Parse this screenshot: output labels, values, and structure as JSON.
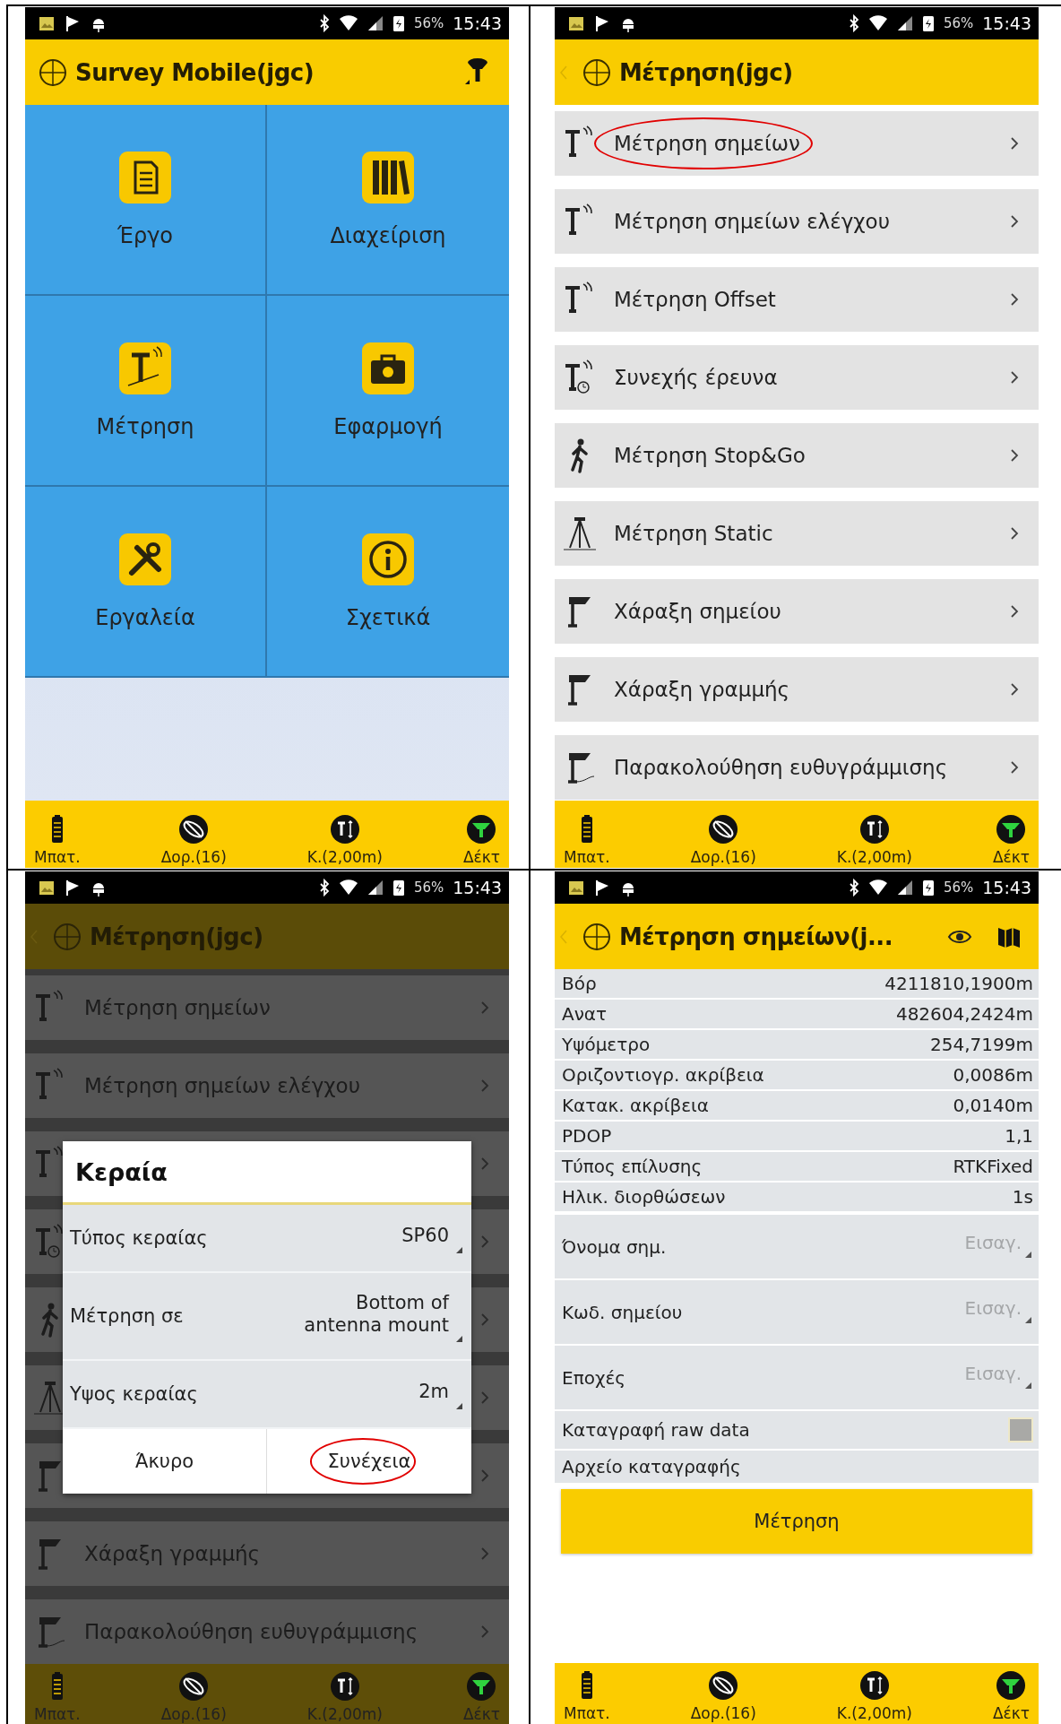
{
  "screens": [
    {
      "kind": "menu_grid",
      "dimmed": false,
      "status_bar": {
        "battery_text": "56%",
        "time": "15:43"
      },
      "header": {
        "title": "Survey Mobile(jgc)",
        "back": false
      },
      "tiles": [
        {
          "label": "Έργο"
        },
        {
          "label": "Διαχείριση"
        },
        {
          "label": "Μέτρηση"
        },
        {
          "label": "Εφαρμογή"
        },
        {
          "label": "Εργαλεία"
        },
        {
          "label": "Σχετικά"
        }
      ],
      "bottom_bar": [
        {
          "label": "Μπατ."
        },
        {
          "label": "Δορ.(16)"
        },
        {
          "label": "Κ.(2,00m)"
        },
        {
          "label": "Δέκτ"
        }
      ]
    },
    {
      "kind": "list",
      "dimmed": false,
      "status_bar": {
        "battery_text": "56%",
        "time": "15:43"
      },
      "header": {
        "title": "Μέτρηση(jgc)",
        "back": true
      },
      "items": [
        {
          "label": "Μέτρηση σημείων",
          "highlighted": true
        },
        {
          "label": "Μέτρηση σημείων ελέγχου",
          "highlighted": false
        },
        {
          "label": "Μέτρηση Offset",
          "highlighted": false
        },
        {
          "label": "Συνεχής έρευνα",
          "highlighted": false
        },
        {
          "label": "Μέτρηση Stop&Go",
          "highlighted": false
        },
        {
          "label": "Μέτρηση Static",
          "highlighted": false
        },
        {
          "label": "Χάραξη σημείου",
          "highlighted": false
        },
        {
          "label": "Χάραξη γραμμής",
          "highlighted": false
        },
        {
          "label": "Παρακολούθηση ευθυγράμμισης",
          "highlighted": false
        }
      ],
      "bottom_bar": [
        {
          "label": "Μπατ."
        },
        {
          "label": "Δορ.(16)"
        },
        {
          "label": "Κ.(2,00m)"
        },
        {
          "label": "Δέκτ"
        }
      ]
    },
    {
      "kind": "list",
      "dimmed": true,
      "status_bar": {
        "battery_text": "56%",
        "time": "15:43"
      },
      "header": {
        "title": "Μέτρηση(jgc)",
        "back": true
      },
      "items": [
        {
          "label": "Μέτρηση σημείων",
          "highlighted": false
        },
        {
          "label": "Μέτρηση σημείων ελέγχου",
          "highlighted": false
        },
        {
          "kind": "covered"
        },
        {
          "kind": "covered"
        },
        {
          "kind": "covered"
        },
        {
          "kind": "covered"
        },
        {
          "kind": "covered"
        },
        {
          "label": "Χάραξη γραμμής",
          "highlighted": false
        },
        {
          "label": "Παρακολούθηση ευθυγράμμισης",
          "highlighted": false
        }
      ],
      "dialog": {
        "title": "Κεραία",
        "rows": [
          {
            "label": "Τύπος κεραίας",
            "value": "SP60"
          },
          {
            "label": "Μέτρηση σε",
            "value": "Bottom of antenna mount"
          },
          {
            "label": "Υψος κεραίας",
            "value": "2m"
          }
        ],
        "buttons": [
          {
            "label": "Άκυρο",
            "highlighted": false
          },
          {
            "label": "Συνέχεια",
            "highlighted": true
          }
        ]
      },
      "bottom_bar": [
        {
          "label": "Μπατ."
        },
        {
          "label": "Δορ.(16)"
        },
        {
          "label": "Κ.(2,00m)"
        },
        {
          "label": "Δέκτ"
        }
      ]
    },
    {
      "kind": "form",
      "dimmed": false,
      "status_bar": {
        "battery_text": "56%",
        "time": "15:43"
      },
      "header": {
        "title": "Μέτρηση σημείων(j...",
        "back": true
      },
      "readings": [
        {
          "label": "Βόρ",
          "value": "4211810,1900m"
        },
        {
          "label": "Ανατ",
          "value": "482604,2424m"
        },
        {
          "label": "Υψόμετρο",
          "value": "254,7199m"
        },
        {
          "label": "Οριζοντιογρ. ακρίβεια",
          "value": "0,0086m"
        },
        {
          "label": "Κατακ. ακρίβεια",
          "value": "0,0140m"
        },
        {
          "label": "PDOP",
          "value": "1,1"
        },
        {
          "label": "Τύπος επίλυσης",
          "value": "RTKFixed"
        },
        {
          "label": "Ηλικ. διορθώσεων",
          "value": "1s"
        }
      ],
      "inputs": [
        {
          "label": "Όνομα σημ.",
          "placeholder": "Εισαγ."
        },
        {
          "label": "Κωδ. σημείου",
          "placeholder": "Εισαγ."
        },
        {
          "label": "Εποχές",
          "placeholder": "Εισαγ."
        }
      ],
      "options": [
        {
          "kind": "checkbox",
          "label": "Καταγραφή raw data",
          "checked": false
        },
        {
          "kind": "text",
          "label": "Αρχείο καταγραφής"
        }
      ],
      "action_button": "Μέτρηση",
      "bottom_bar": [
        {
          "label": "Μπατ."
        },
        {
          "label": "Δορ.(16)"
        },
        {
          "label": "Κ.(2,00m)"
        },
        {
          "label": "Δέκτ"
        }
      ]
    }
  ]
}
